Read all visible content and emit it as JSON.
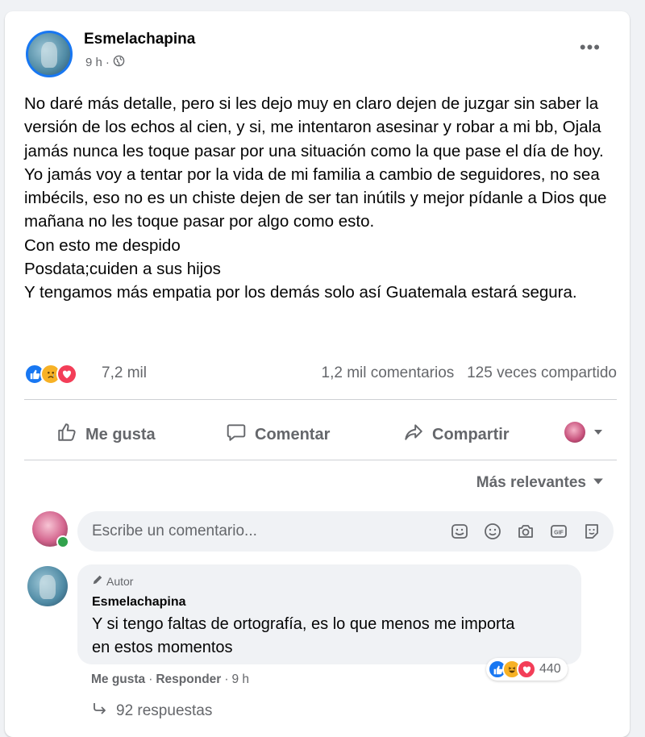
{
  "post": {
    "author": "Esmelachapina",
    "time": "9 h",
    "privacy_icon": "globe-icon",
    "more_label": "•••",
    "paragraphs": [
      "No daré más detalle, pero si les dejo muy en claro dejen de juzgar sin saber la versión de los echos al cien, y si, me intentaron asesinar y robar a mi bb, Ojala jamás nunca les toque pasar por una situación como la que pase el día de hoy. Yo jamás voy a tentar por la vida de mi  familia a cambio de seguidores, no sea imbécils, eso no es un chiste dejen de ser tan inútils y mejor pídanle a Dios que mañana no les toque pasar por algo como esto.",
      "Con esto me despido",
      "Posdata;cuiden a sus hijos",
      "Y tengamos más empatia por los demás solo así Guatemala estará segura."
    ],
    "reactions": [
      "like",
      "sad",
      "love"
    ],
    "reaction_count": "7,2 mil",
    "comments_count": "1,2 mil comentarios",
    "shares_count": "125 veces compartido"
  },
  "actions": {
    "like": "Me gusta",
    "comment": "Comentar",
    "share": "Compartir"
  },
  "comments_section": {
    "sort_label": "Más relevantes",
    "input_placeholder": "Escribe un comentario...",
    "input_icons": [
      "sticker-icon",
      "emoji-icon",
      "camera-icon",
      "gif-icon",
      "avatar-sticker-icon"
    ]
  },
  "comment": {
    "badge": "Autor",
    "author": "Esmelachapina",
    "text": "Y si tengo faltas de ortografía, es lo que menos me importa en estos momentos",
    "reactions": [
      "like",
      "haha",
      "love"
    ],
    "reaction_count": "440",
    "like_label": "Me gusta",
    "separator": "·",
    "reply_label": "Responder",
    "time": "9 h",
    "replies_label": "92 respuestas"
  },
  "colors": {
    "like_blue": "#1877f2",
    "love_red": "#f33e58",
    "sad_yellow": "#f7b125",
    "text_secondary": "#65676b",
    "online_green": "#31a24c"
  }
}
